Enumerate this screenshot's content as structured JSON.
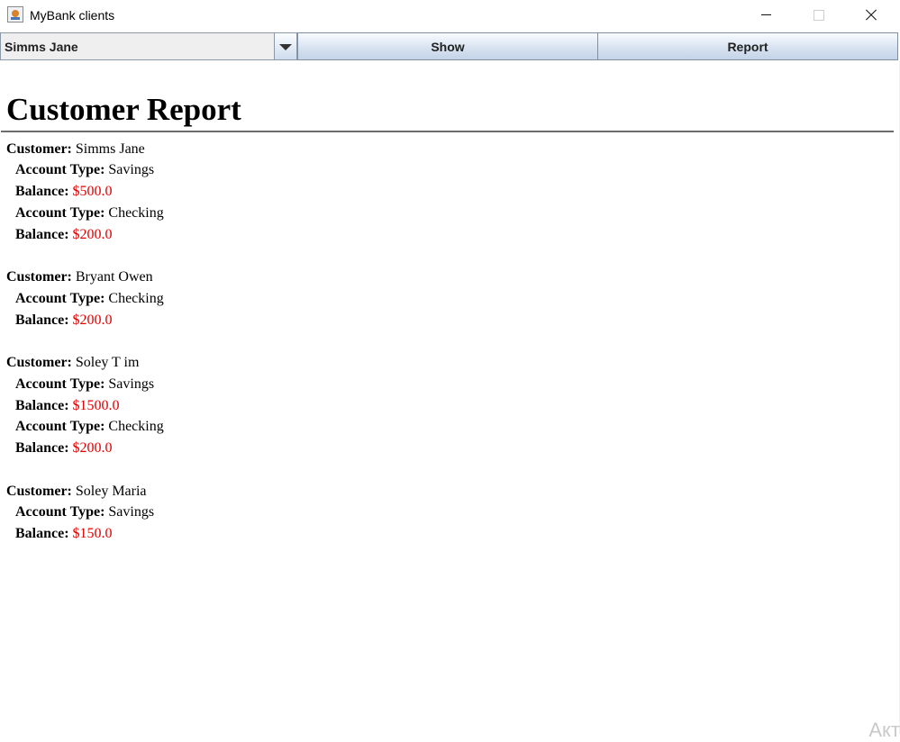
{
  "window": {
    "title": "MyBank clients"
  },
  "toolbar": {
    "customer_select": "Simms Jane",
    "show_button": "Show",
    "report_button": "Report"
  },
  "report": {
    "title": "Customer Report",
    "customers": [
      {
        "label": "Customer:",
        "name": "Simms Jane",
        "accounts": [
          {
            "type_label": "Account Type:",
            "type": "Savings",
            "balance_label": "Balance:",
            "balance": "$500.0"
          },
          {
            "type_label": "Account Type:",
            "type": "Checking",
            "balance_label": "Balance:",
            "balance": "$200.0"
          }
        ]
      },
      {
        "label": "Customer:",
        "name": "Bryant Owen",
        "accounts": [
          {
            "type_label": "Account Type:",
            "type": "Checking",
            "balance_label": "Balance:",
            "balance": "$200.0"
          }
        ]
      },
      {
        "label": "Customer:",
        "name": "Soley T im",
        "accounts": [
          {
            "type_label": "Account Type:",
            "type": "Savings",
            "balance_label": "Balance:",
            "balance": "$1500.0"
          },
          {
            "type_label": "Account Type:",
            "type": "Checking",
            "balance_label": "Balance:",
            "balance": "$200.0"
          }
        ]
      },
      {
        "label": "Customer:",
        "name": "Soley Maria",
        "accounts": [
          {
            "type_label": "Account Type:",
            "type": "Savings",
            "balance_label": "Balance:",
            "balance": "$150.0"
          }
        ]
      }
    ]
  },
  "overlay": {
    "watermark": "Акт"
  }
}
